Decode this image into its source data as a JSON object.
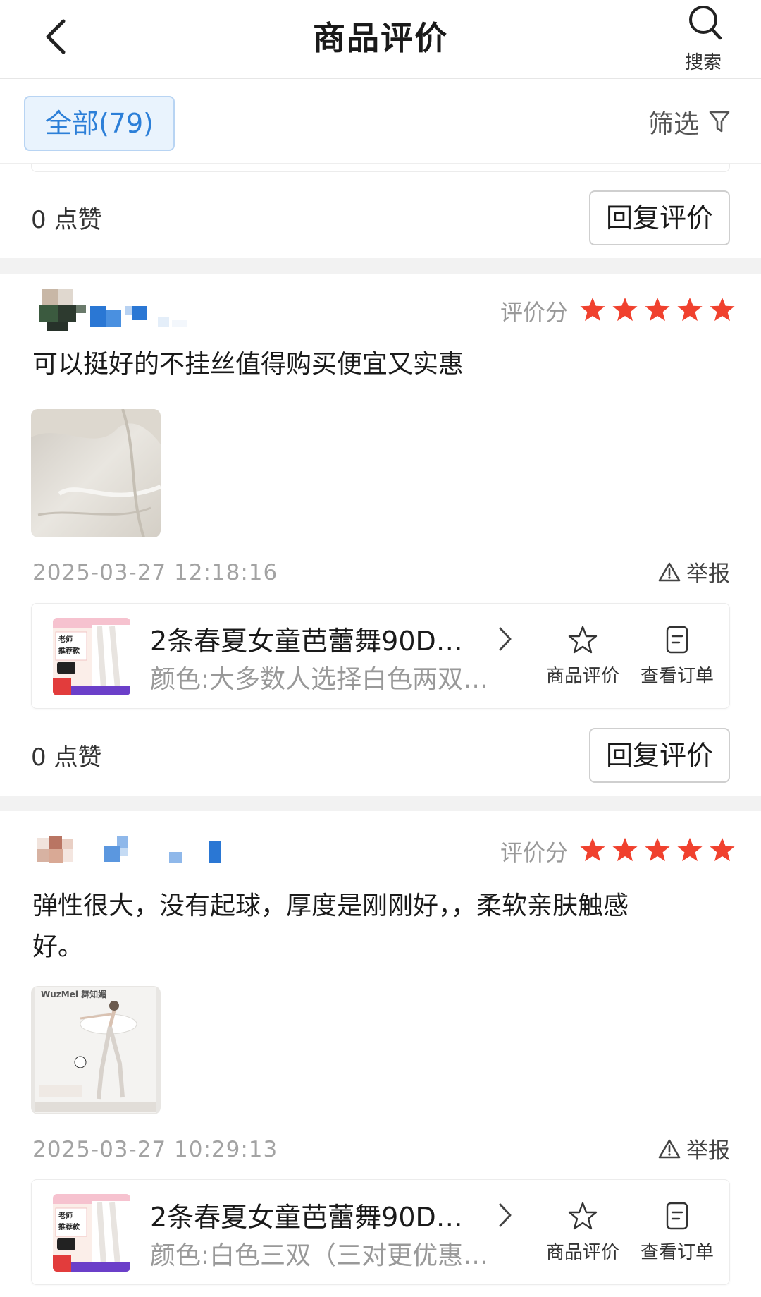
{
  "header": {
    "title": "商品评价",
    "search_label": "搜索"
  },
  "filter": {
    "all_tab": "全部(79)",
    "filter_label": "筛选"
  },
  "top_like_row": {
    "likes": "0 点赞",
    "reply": "回复评价"
  },
  "reviews": [
    {
      "score_label": "评价分",
      "rating": 5,
      "text": "可以挺好的不挂丝值得购买便宜又实惠",
      "timestamp": "2025-03-27 12:18:16",
      "report": "举报",
      "product": {
        "name": "2条春夏女童芭蕾舞90D…",
        "variant": "颜色:大多数人选择白色两双…",
        "review_action": "商品评价",
        "order_action": "查看订单",
        "thumb_tags": [
          "老师",
          "推荐款"
        ]
      },
      "likes": "0 点赞",
      "reply": "回复评价"
    },
    {
      "score_label": "评价分",
      "rating": 5,
      "text": "弹性很大，没有起球，厚度是刚刚好，，柔软亲肤触感好。",
      "photo_brand": "WuzMei 舞知媚",
      "timestamp": "2025-03-27 10:29:13",
      "report": "举报",
      "product": {
        "name": "2条春夏女童芭蕾舞90D…",
        "variant": "颜色:白色三双（三对更优惠…",
        "review_action": "商品评价",
        "order_action": "查看订单",
        "thumb_tags": [
          "老师",
          "推荐款"
        ]
      }
    }
  ],
  "colors": {
    "accent": "#2c7fd8",
    "star": "#f0412e",
    "muted": "#a3a3a3"
  }
}
